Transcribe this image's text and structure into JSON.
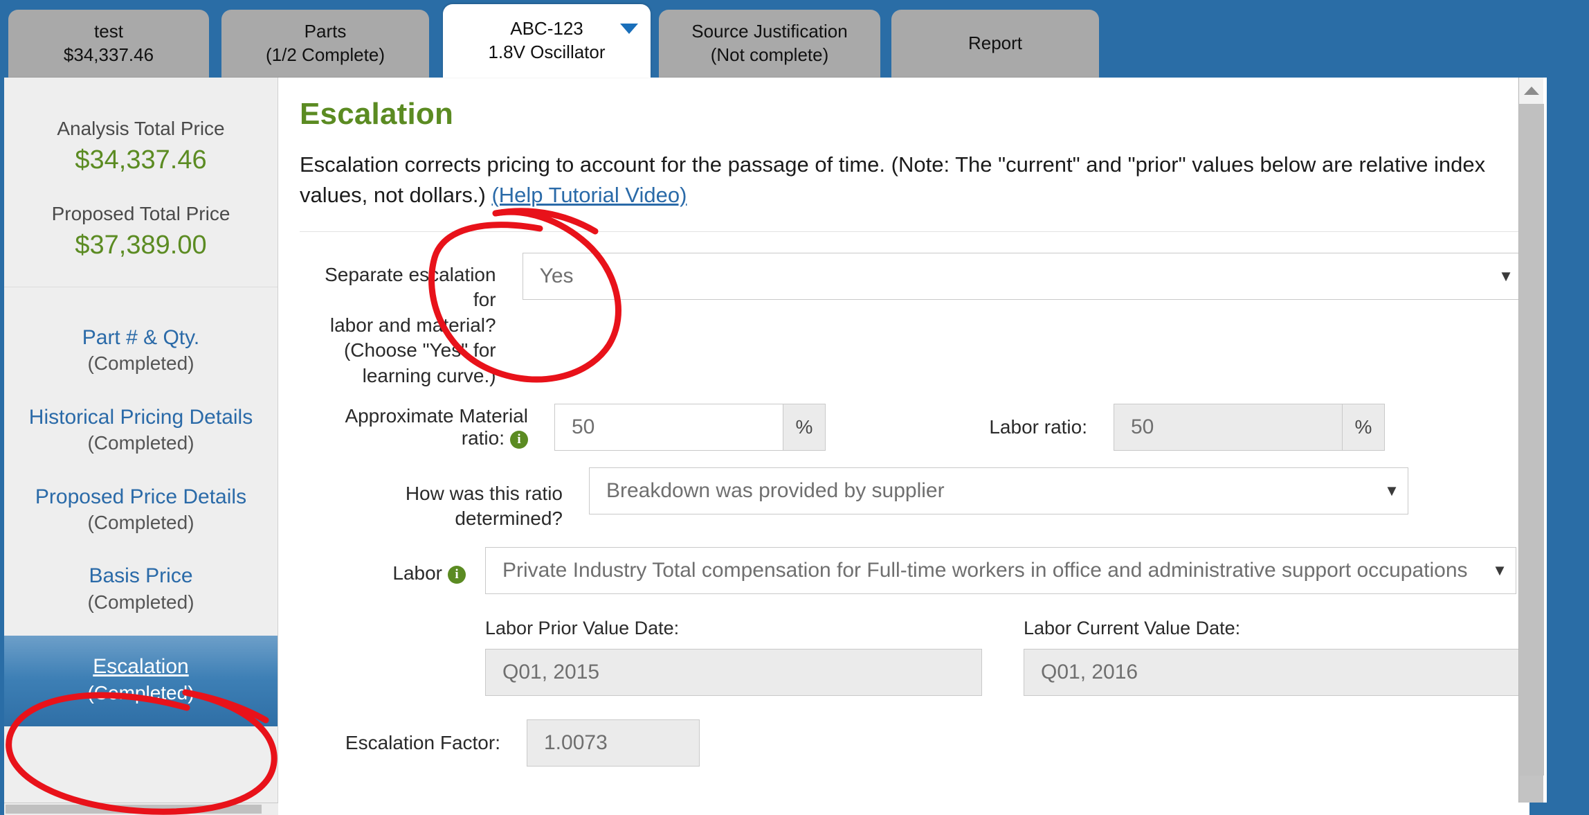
{
  "window": {
    "accent_blue": "#2a6da6",
    "green": "#5b8b22",
    "link_blue": "#2a6aa8",
    "annotation_color": "#e8121a"
  },
  "tabs": [
    {
      "line1": "test",
      "line2": "$34,337.46",
      "active": false,
      "caret": false
    },
    {
      "line1": "Parts",
      "line2": "(1/2 Complete)",
      "active": false,
      "caret": false
    },
    {
      "line1": "ABC-123",
      "line2": "1.8V Oscillator",
      "active": true,
      "caret": true
    },
    {
      "line1": "Source Justification",
      "line2": "(Not complete)",
      "active": false,
      "caret": false
    },
    {
      "line1": "Report",
      "line2": "",
      "active": false,
      "caret": false
    }
  ],
  "sidebar": {
    "totals": [
      {
        "label": "Analysis Total Price",
        "value": "$34,337.46"
      },
      {
        "label": "Proposed Total Price",
        "value": "$37,389.00"
      }
    ],
    "nav": [
      {
        "link": "Part # & Qty.",
        "state": "(Completed)",
        "selected": false
      },
      {
        "link": "Historical Pricing Details",
        "state": "(Completed)",
        "selected": false
      },
      {
        "link": "Proposed Price Details",
        "state": "(Completed)",
        "selected": false
      },
      {
        "link": "Basis Price",
        "state": "(Completed)",
        "selected": false
      },
      {
        "link": "Escalation",
        "state": "(Completed)",
        "selected": true
      }
    ]
  },
  "main": {
    "title": "Escalation",
    "description": "Escalation corrects pricing to account for the passage of time. (Note: The \"current\" and \"prior\" values below are relative index values, not dollars.)",
    "help_link": "(Help Tutorial Video)",
    "form": {
      "separate_escalation": {
        "label": "Separate escalation for labor and material? (Choose \"Yes\" for learning curve.)",
        "label_lines": [
          "Separate escalation for",
          "labor and material?",
          "(Choose \"Yes\" for",
          "learning curve.)"
        ],
        "value": "Yes"
      },
      "material_ratio": {
        "label": "Approximate Material ratio:",
        "value": "50",
        "unit": "%",
        "info_icon": "info-icon"
      },
      "labor_ratio": {
        "label": "Labor ratio:",
        "value": "50",
        "unit": "%",
        "disabled": true
      },
      "ratio_determined": {
        "label": "How was this ratio determined?",
        "value": "Breakdown was provided by supplier"
      },
      "labor_index": {
        "label": "Labor",
        "value": "Private Industry Total compensation for Full-time workers in office and administrative support occupations",
        "info_icon": "info-icon"
      },
      "labor_prior_value_date": {
        "label": "Labor Prior Value Date:",
        "value": "Q01, 2015"
      },
      "labor_current_value_date": {
        "label": "Labor Current Value Date:",
        "value": "Q01, 2016"
      },
      "escalation_factor": {
        "label": "Escalation Factor:",
        "value": "1.0073"
      }
    }
  },
  "scrollbars": {
    "vertical_up_icon": "arrow-up-icon",
    "horizontal_thumb": "horizontal-scroll-thumb"
  },
  "annotations": [
    {
      "name": "circle-around-separate-escalation-dropdown",
      "shape": "ellipse"
    },
    {
      "name": "circle-around-escalation-sidebar-item",
      "shape": "ellipse"
    }
  ]
}
